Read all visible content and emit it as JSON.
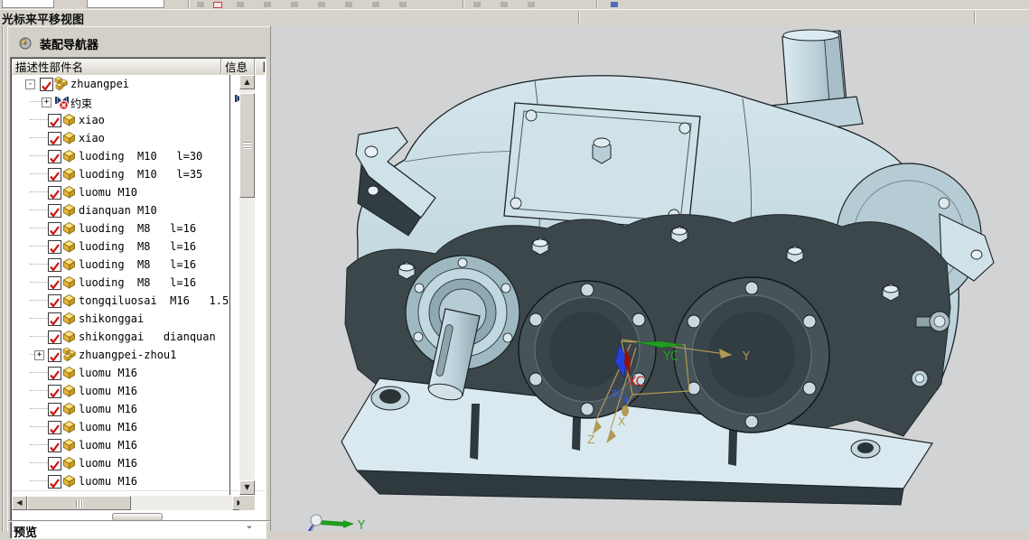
{
  "status_bar": {
    "message": "光标来平移视图"
  },
  "assembly_navigator": {
    "title": "装配导航器",
    "columns": {
      "name": "描述性部件名",
      "info": "信息",
      "clipped_fragment": "丨"
    },
    "preview": {
      "label": "预览",
      "collapse_glyph": "⌄"
    },
    "tree": [
      {
        "label": "zhuangpei",
        "icon": "assembly",
        "slot": "root",
        "expander": "-",
        "checked": true
      },
      {
        "label": "约束",
        "icon": "constraints",
        "slot": "cons",
        "expander": "+",
        "checked": null,
        "info_icon": "constraints"
      },
      {
        "label": "xiao",
        "icon": "part",
        "slot": "part",
        "checked": true
      },
      {
        "label": "xiao",
        "icon": "part",
        "slot": "part",
        "checked": true
      },
      {
        "label": "luoding  M10   l=30",
        "icon": "part",
        "slot": "part",
        "checked": true
      },
      {
        "label": "luoding  M10   l=35",
        "icon": "part",
        "slot": "part",
        "checked": true
      },
      {
        "label": "luomu M10",
        "icon": "part",
        "slot": "part",
        "checked": true
      },
      {
        "label": "dianquan M10",
        "icon": "part",
        "slot": "part",
        "checked": true
      },
      {
        "label": "luoding  M8   l=16",
        "icon": "part",
        "slot": "part",
        "checked": true
      },
      {
        "label": "luoding  M8   l=16",
        "icon": "part",
        "slot": "part",
        "checked": true
      },
      {
        "label": "luoding  M8   l=16",
        "icon": "part",
        "slot": "part",
        "checked": true
      },
      {
        "label": "luoding  M8   l=16",
        "icon": "part",
        "slot": "part",
        "checked": true
      },
      {
        "label": "tongqiluosai  M16   1.5",
        "icon": "part",
        "slot": "part",
        "checked": true
      },
      {
        "label": "shikonggai",
        "icon": "part",
        "slot": "part",
        "checked": true
      },
      {
        "label": "shikonggai   dianquan",
        "icon": "part",
        "slot": "part",
        "checked": true
      },
      {
        "label": "zhuangpei-zhou1",
        "icon": "assembly",
        "slot": "sub",
        "expander": "+",
        "checked": true
      },
      {
        "label": "luomu M16",
        "icon": "part",
        "slot": "part",
        "checked": true
      },
      {
        "label": "luomu M16",
        "icon": "part",
        "slot": "part",
        "checked": true
      },
      {
        "label": "luomu M16",
        "icon": "part",
        "slot": "part",
        "checked": true
      },
      {
        "label": "luomu M16",
        "icon": "part",
        "slot": "part",
        "checked": true
      },
      {
        "label": "luomu M16",
        "icon": "part",
        "slot": "part",
        "checked": true
      },
      {
        "label": "luomu M16",
        "icon": "part",
        "slot": "part",
        "checked": true
      },
      {
        "label": "luomu M16",
        "icon": "part",
        "slot": "part",
        "checked": true
      }
    ]
  },
  "viewport": {
    "model_name": "gearbox-assembly-3d-model",
    "wcs_labels": {
      "yc": "YC",
      "xc": "XC",
      "zc": "ZC",
      "y": "Y",
      "x": "X",
      "z": "Z",
      "origin": "+"
    },
    "view_triad": {
      "y": "Y"
    },
    "colors": {
      "background": "#d2d3d5",
      "body_light": "#c6dbe3",
      "body_lighter": "#dcebf1",
      "body_mid": "#9fb9c3",
      "body_dark": "#3b474b",
      "edge": "#1c2224",
      "wcs_tan": "#b29a56",
      "wcs_green": "#1f9e1f",
      "wcs_red": "#cc2222",
      "wcs_blue": "#2342dd"
    }
  }
}
